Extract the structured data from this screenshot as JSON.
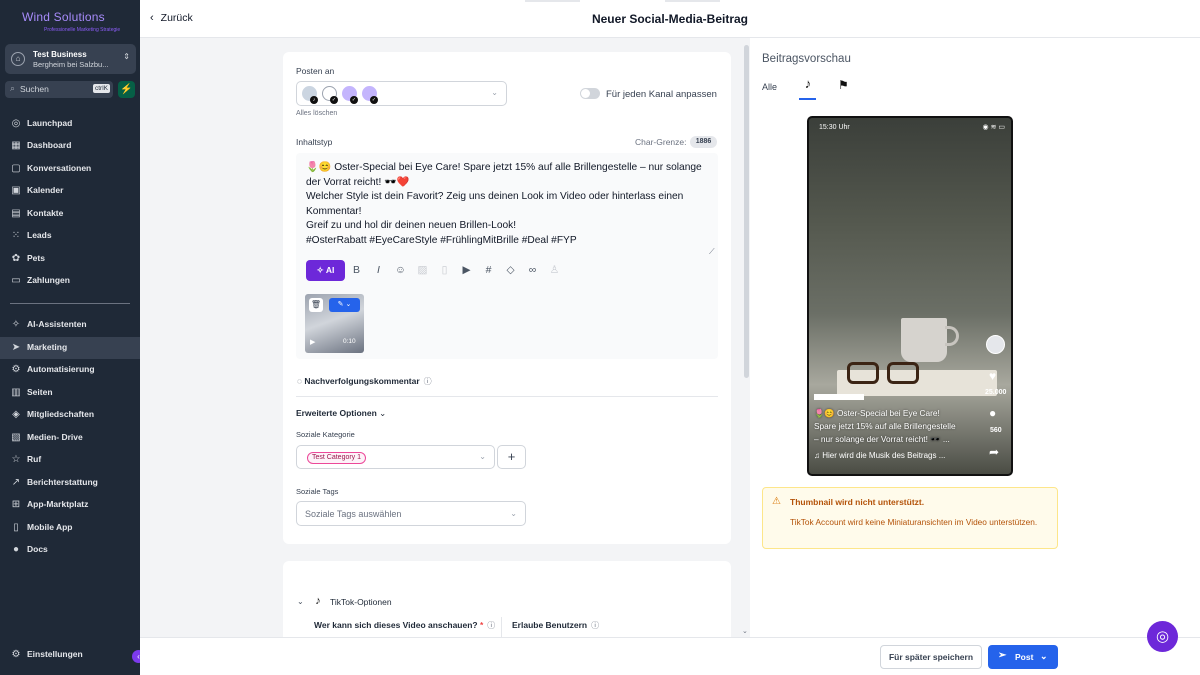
{
  "brand": {
    "name": "Wind Solutions",
    "tagline": "Professionelle Marketing Strategie"
  },
  "account": {
    "name": "Test Business",
    "location": "Bergheim bei Salzbu..."
  },
  "search": {
    "placeholder": "Suchen",
    "shortcut": "ctrlK"
  },
  "nav": [
    {
      "label": "Launchpad",
      "icon": "rocket-icon"
    },
    {
      "label": "Dashboard",
      "icon": "grid-icon"
    },
    {
      "label": "Konversationen",
      "icon": "chat-icon"
    },
    {
      "label": "Kalender",
      "icon": "calendar-icon"
    },
    {
      "label": "Kontakte",
      "icon": "contacts-icon"
    },
    {
      "label": "Leads",
      "icon": "leads-icon"
    },
    {
      "label": "Pets",
      "icon": "paw-icon"
    },
    {
      "label": "Zahlungen",
      "icon": "payment-icon"
    },
    {
      "label": "AI-Assistenten",
      "icon": "sparkle-icon"
    },
    {
      "label": "Marketing",
      "icon": "send-icon",
      "active": true
    },
    {
      "label": "Automatisierung",
      "icon": "automation-icon"
    },
    {
      "label": "Seiten",
      "icon": "pages-icon"
    },
    {
      "label": "Mitgliedschaften",
      "icon": "membership-icon"
    },
    {
      "label": "Medien- Drive",
      "icon": "media-icon"
    },
    {
      "label": "Ruf",
      "icon": "star-icon"
    },
    {
      "label": "Berichterstattung",
      "icon": "chart-icon"
    },
    {
      "label": "App-Marktplatz",
      "icon": "apps-icon"
    },
    {
      "label": "Mobile App",
      "icon": "mobile-icon"
    },
    {
      "label": "Docs",
      "icon": "info-icon"
    },
    {
      "label": "Einstellungen",
      "icon": "gear-icon"
    }
  ],
  "header": {
    "back_label": "Zurück",
    "title": "Neuer Social-Media-Beitrag"
  },
  "form": {
    "post_to_label": "Posten an",
    "clear_all_label": "Alles löschen",
    "per_channel_label": "Für jeden Kanal anpassen",
    "content_type_label": "Inhaltstyp",
    "char_limit_label": "Char-Grenze:",
    "char_limit_value": "1886",
    "content_lines": [
      "🌷😊 Oster-Special bei Eye Care! Spare jetzt 15% auf alle Brillengestelle – nur solange",
      "der Vorrat reicht! 🕶️❤️",
      "Welcher Style ist dein Favorit? Zeig uns deinen Look im Video oder hinterlass einen",
      "Kommentar!",
      "Greif zu und hol dir deinen neuen Brillen-Look!",
      "#OsterRabatt #EyeCareStyle #FrühlingMitBrille #Deal #FYP"
    ],
    "ai_label": "AI",
    "video_duration": "0:10",
    "followup_label": "Nachverfolgungskommentar",
    "advanced_label": "Erweiterte Optionen",
    "category_label": "Soziale Kategorie",
    "category_tag": "Test Category 1",
    "tags_label": "Soziale Tags",
    "tags_placeholder": "Soziale Tags auswählen"
  },
  "tiktok_options": {
    "title": "TikTok-Optionen",
    "who_can_view_label": "Wer kann sich dieses Video anschauen?",
    "allow_users_label": "Erlaube Benutzern"
  },
  "preview": {
    "title": "Beitragsvorschau",
    "tab_all": "Alle",
    "time": "15:30 Uhr",
    "likes": "25.000",
    "comments": "560",
    "caption_lines": [
      "🌷😊 Oster-Special bei Eye Care!",
      "Spare jetzt 15% auf alle Brillengestelle",
      "– nur solange der Vorrat reicht! 🕶️ ..."
    ],
    "music": "Hier wird die Musik des Beitrags ...",
    "warning_title": "Thumbnail wird nicht unterstützt.",
    "warning_text": "TikTok Account wird keine Miniaturansichten im Video unterstützen."
  },
  "footer": {
    "save_later_label": "Für später speichern",
    "post_label": "Post"
  },
  "colors": {
    "sidebar_bg": "#1f2937",
    "accent": "#2563eb",
    "ai_purple": "#6d28d9",
    "warning": "#b45309"
  }
}
